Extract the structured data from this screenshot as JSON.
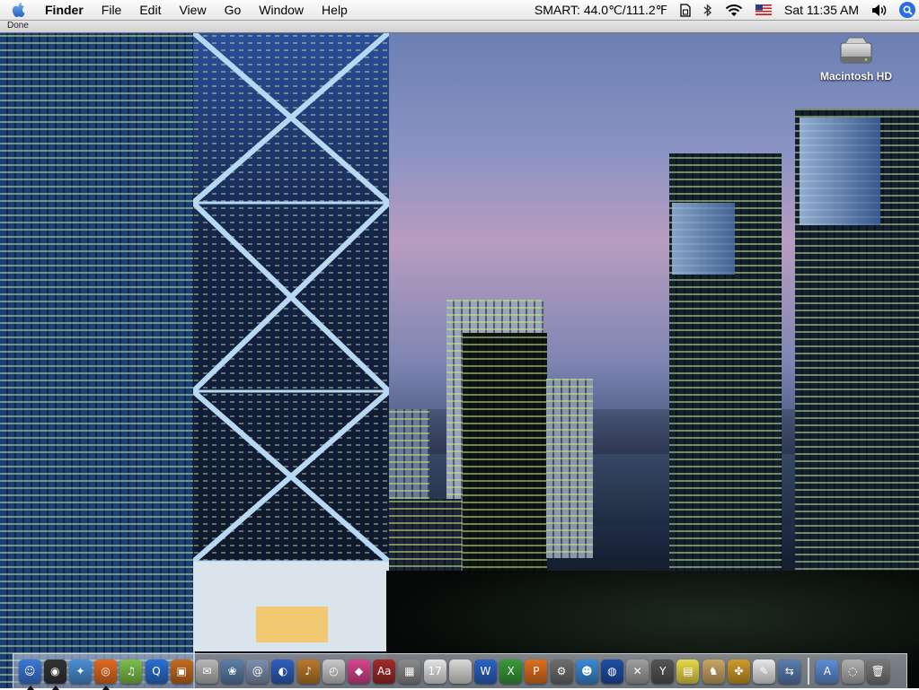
{
  "menubar": {
    "app_name": "Finder",
    "items": [
      "File",
      "Edit",
      "View",
      "Go",
      "Window",
      "Help"
    ],
    "smart_status": "SMART:  44.0℃/111.2℉",
    "clock": "Sat 11:35 AM"
  },
  "status_strip": {
    "text": "Done"
  },
  "desktop": {
    "drive_label": "Macintosh HD"
  },
  "dock": {
    "apps": [
      {
        "icon": "finder-icon",
        "color": "#3b78d8",
        "glyph": "☺",
        "running": true
      },
      {
        "icon": "dashboard-icon",
        "color": "#333333",
        "glyph": "◉",
        "running": true
      },
      {
        "icon": "safari-icon",
        "color": "#4a8fd6",
        "glyph": "✦",
        "running": false
      },
      {
        "icon": "firefox-icon",
        "color": "#e36a1e",
        "glyph": "◎",
        "running": true
      },
      {
        "icon": "itunes-icon",
        "color": "#7cbf4a",
        "glyph": "♫",
        "running": false
      },
      {
        "icon": "quicktime-icon",
        "color": "#2a6fd0",
        "glyph": "Q",
        "running": false
      },
      {
        "icon": "preview-icon",
        "color": "#c46a1e",
        "glyph": "▣",
        "running": false
      },
      {
        "icon": "mail-stamp-icon",
        "color": "#b7b7b7",
        "glyph": "✉",
        "running": false
      },
      {
        "icon": "iphoto-icon",
        "color": "#5b7fa8",
        "glyph": "❀",
        "running": false
      },
      {
        "icon": "address-book-icon",
        "color": "#7e8fb0",
        "glyph": "@",
        "running": false
      },
      {
        "icon": "dvd-player-icon",
        "color": "#2f5fbf",
        "glyph": "◐",
        "running": false
      },
      {
        "icon": "garageband-icon",
        "color": "#b9792a",
        "glyph": "♪",
        "running": false
      },
      {
        "icon": "stopwatch-icon",
        "color": "#c9c9c9",
        "glyph": "◴",
        "running": false
      },
      {
        "icon": "color-picker-icon",
        "color": "#d6468c",
        "glyph": "◆",
        "running": false
      },
      {
        "icon": "dictionary-icon",
        "color": "#a22a2a",
        "glyph": "Aa",
        "running": false
      },
      {
        "icon": "calculator-icon",
        "color": "#8a8a8a",
        "glyph": "▦",
        "running": false
      },
      {
        "icon": "ical-icon",
        "color": "#e5e5e5",
        "glyph": "17",
        "running": false
      },
      {
        "icon": "apple-store-icon",
        "color": "#dadada",
        "glyph": "",
        "running": false
      },
      {
        "icon": "word-icon",
        "color": "#2a64c4",
        "glyph": "W",
        "running": false
      },
      {
        "icon": "excel-icon",
        "color": "#3a9a3a",
        "glyph": "X",
        "running": false
      },
      {
        "icon": "powerpoint-icon",
        "color": "#e0701e",
        "glyph": "P",
        "running": false
      },
      {
        "icon": "automator-icon",
        "color": "#6d6d6d",
        "glyph": "⚙",
        "running": false
      },
      {
        "icon": "messenger-icon",
        "color": "#3a8ad6",
        "glyph": "☻",
        "running": false
      },
      {
        "icon": "google-earth-icon",
        "color": "#1f4fa8",
        "glyph": "◍",
        "running": false
      },
      {
        "icon": "utilities-icon",
        "color": "#a0a0a0",
        "glyph": "✕",
        "running": false
      },
      {
        "icon": "yahoo-widgets-icon",
        "color": "#555555",
        "glyph": "Y",
        "running": false
      },
      {
        "icon": "stickies-icon",
        "color": "#e9d84a",
        "glyph": "▤",
        "running": false
      },
      {
        "icon": "chess-icon",
        "color": "#caa565",
        "glyph": "♞",
        "running": false
      },
      {
        "icon": "pineapple-icon",
        "color": "#cf9a2a",
        "glyph": "✤",
        "running": false
      },
      {
        "icon": "text-edit-icon",
        "color": "#e8e8e8",
        "glyph": "✎",
        "running": false
      },
      {
        "icon": "network-icon",
        "color": "#5a7db0",
        "glyph": "⇆",
        "running": false
      }
    ],
    "right_items": [
      {
        "icon": "applications-folder-icon",
        "color": "#5d8ed6",
        "glyph": "A"
      },
      {
        "icon": "downloads-stack-icon",
        "color": "#b0b0b0",
        "glyph": "◌"
      },
      {
        "icon": "trash-icon",
        "color": "#7a7a7a",
        "glyph": "🗑"
      }
    ]
  }
}
